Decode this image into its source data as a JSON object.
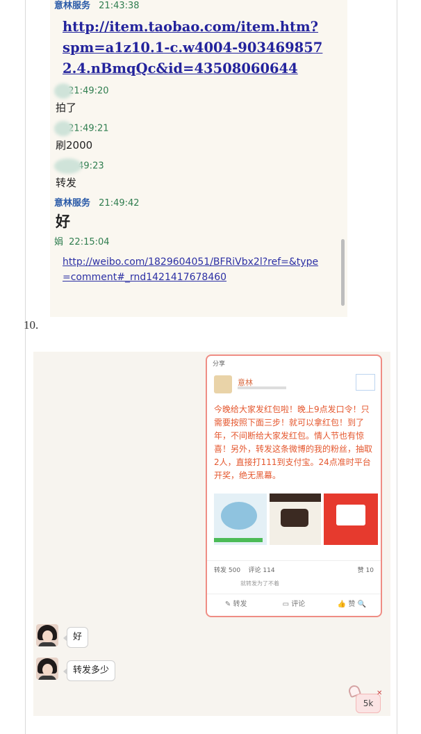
{
  "chat_log": {
    "messages": [
      {
        "sender": "意林服务",
        "time": "21:43:38",
        "link": "http://item.taobao.com/item.htm?spm=a1z10.1-c.w4004-9034698572.4.nBmqQc&id=43508060644"
      },
      {
        "sender": "",
        "time": "21:49:20",
        "text": "拍了"
      },
      {
        "sender": "",
        "time": "21:49:21",
        "text": "刷2000"
      },
      {
        "sender": "",
        "time": "49:23",
        "text": "转发"
      },
      {
        "sender": "意林服务",
        "time": "21:49:42",
        "text": "好"
      },
      {
        "sender": "娟",
        "time": "22:15:04",
        "link": "http://weibo.com/1829604051/BFRiVbx2l?ref=&type=comment#_rnd1421417678460"
      }
    ]
  },
  "section_number": "10.",
  "weibo_card": {
    "top_label": "分享",
    "poster_name": "意林",
    "post_text": "今晚给大家发红包啦！晚上9点发口令！只需要按照下面三步！就可以拿红包！到了年，不间断给大家发红包。情人节也有惊喜！另外，转发这条微博的我的粉丝，抽取2人，直接打111到支付宝。24点准时平台开奖，绝无黑幕。",
    "stats_left": "转发 500",
    "stats_mid": "评论 114",
    "stats_right": "赞 10",
    "comment_preview": "就转发为了不着",
    "actions": [
      "转发",
      "评论",
      "赞"
    ]
  },
  "replies": [
    {
      "text": "好"
    },
    {
      "text": "转发多少"
    }
  ],
  "float_button": {
    "label": "5k"
  },
  "colors": {
    "accent_link": "#23239c",
    "card_border": "#ef8d84",
    "post_text": "#e4572e"
  }
}
